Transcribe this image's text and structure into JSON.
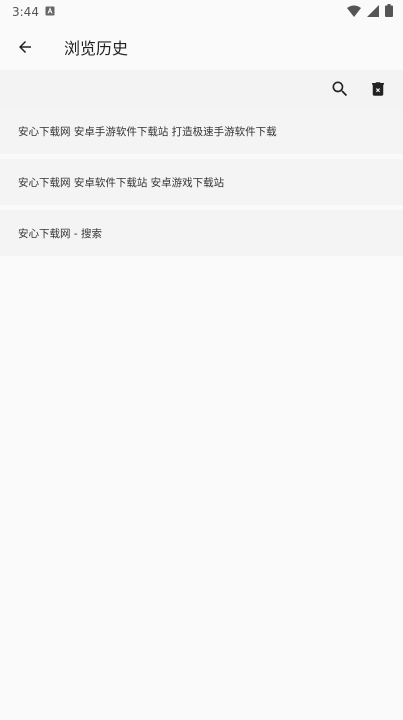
{
  "status_bar": {
    "time": "3:44"
  },
  "header": {
    "title": "浏览历史"
  },
  "toolbar": {
    "icons": [
      "search-icon",
      "delete-icon"
    ]
  },
  "history": [
    {
      "title": "安心下载网 安卓手游软件下载站 打造极速手游软件下载"
    },
    {
      "title": "安心下载网 安卓软件下载站 安卓游戏下载站"
    },
    {
      "title": "安心下载网 - 搜索"
    }
  ],
  "colors": {
    "background": "#fafafa",
    "item_bg": "#f4f4f4",
    "text": "#333333"
  }
}
